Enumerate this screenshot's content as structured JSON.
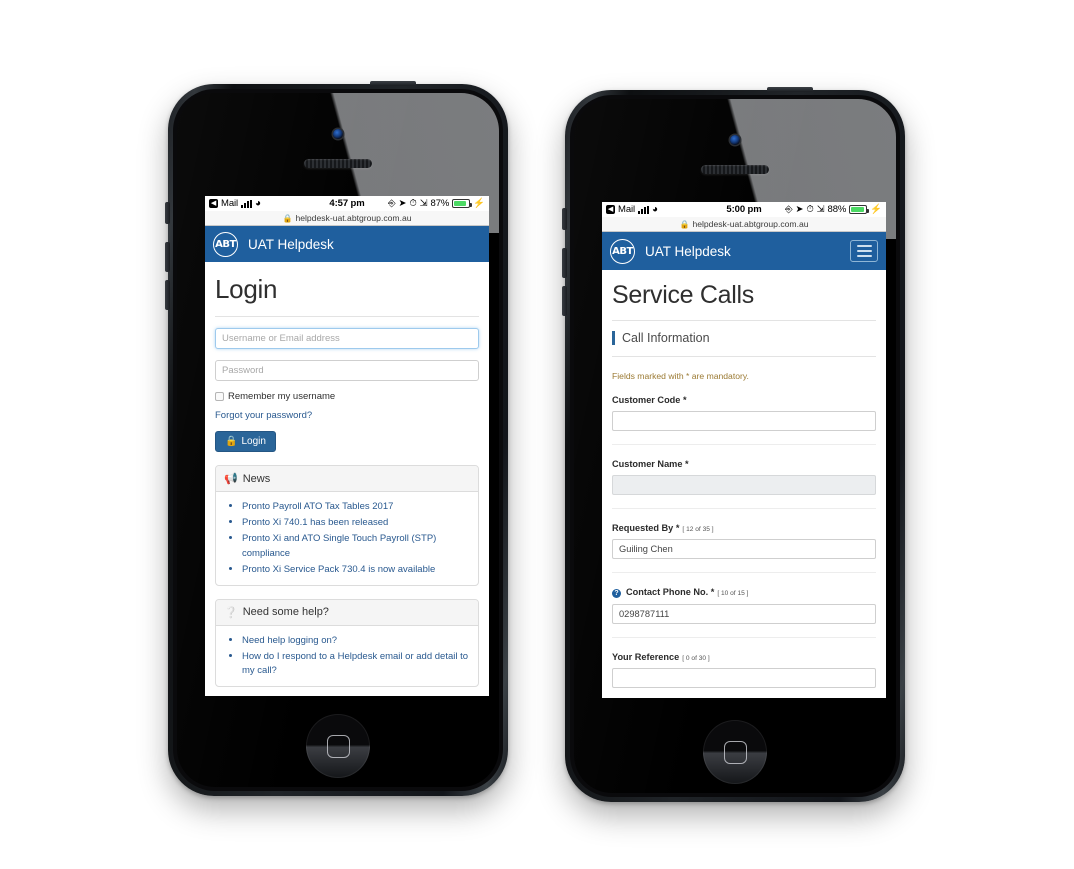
{
  "phones": {
    "left": {
      "status_bar": {
        "back_label": "Mail",
        "back_glyph": "◀",
        "wifi_icon": "wifi-icon",
        "time": "4:57 pm",
        "rotation_lock_icon": "rotation-lock-icon",
        "location_icon": "location-arrow-icon",
        "alarm_icon": "alarm-clock-icon",
        "bluetooth_icon": "bluetooth-icon",
        "battery_percent": "87%",
        "battery_level": 87,
        "charging_icon": "⚡"
      },
      "url_bar": {
        "lock_icon": "🔒",
        "url": "helpdesk-uat.abtgroup.com.au"
      },
      "app_header": {
        "logo_text": "ABT",
        "brand": "UAT Helpdesk",
        "menu_visible": false
      },
      "page": {
        "title": "Login",
        "username": {
          "value": "",
          "placeholder": "Username or Email address"
        },
        "password": {
          "value": "",
          "placeholder": "Password"
        },
        "remember_label": "Remember my username",
        "remember_checked": false,
        "forgot_link": "Forgot your password?",
        "login_button": "Login",
        "login_lock_icon": "🔒",
        "panels": [
          {
            "icon": "megaphone-icon",
            "icon_glyph": "📢",
            "title": "News",
            "items": [
              "Pronto Payroll ATO Tax Tables 2017",
              "Pronto Xi 740.1 has been released",
              "Pronto Xi and ATO Single Touch Payroll (STP) compliance",
              "Pronto Xi Service Pack 730.4 is now available"
            ]
          },
          {
            "icon": "question-circle-icon",
            "icon_glyph": "❓",
            "title": "Need some help?",
            "items": [
              "Need help logging on?",
              "How do I respond to a Helpdesk email or add detail to my call?"
            ]
          }
        ]
      }
    },
    "right": {
      "status_bar": {
        "back_label": "Mail",
        "back_glyph": "◀",
        "wifi_icon": "wifi-icon",
        "time": "5:00 pm",
        "rotation_lock_icon": "rotation-lock-icon",
        "location_icon": "location-arrow-icon",
        "alarm_icon": "alarm-clock-icon",
        "bluetooth_icon": "bluetooth-icon",
        "battery_percent": "88%",
        "battery_level": 88,
        "charging_icon": "⚡"
      },
      "url_bar": {
        "lock_icon": "🔒",
        "url": "helpdesk-uat.abtgroup.com.au"
      },
      "app_header": {
        "logo_text": "ABT",
        "brand": "UAT Helpdesk",
        "menu_visible": true,
        "menu_icon": "hamburger-menu-icon"
      },
      "page": {
        "title": "Service Calls",
        "section_title": "Call Information",
        "mandatory_note": "Fields marked with * are mandatory.",
        "fields": [
          {
            "label": "Customer Code *",
            "counter": "",
            "value": "",
            "disabled": false,
            "has_help": false
          },
          {
            "label": "Customer Name *",
            "counter": "",
            "value": "",
            "disabled": true,
            "has_help": false
          },
          {
            "label": "Requested By *",
            "counter": "[ 12 of 35 ]",
            "value": "Guiling Chen",
            "disabled": false,
            "has_help": false
          },
          {
            "label": "Contact Phone No. *",
            "counter": "[ 10 of 15 ]",
            "value": "0298787111",
            "disabled": false,
            "has_help": true,
            "help_glyph": "?"
          },
          {
            "label": "Your Reference",
            "counter": "[ 0 of 30 ]",
            "value": "",
            "disabled": false,
            "has_help": false
          }
        ]
      }
    }
  },
  "colors": {
    "brand_blue": "#1f5f9e",
    "button_blue": "#2a6599",
    "link_blue": "#29598f",
    "mandatory_gold": "#9b7a33",
    "battery_green": "#4cd964"
  }
}
